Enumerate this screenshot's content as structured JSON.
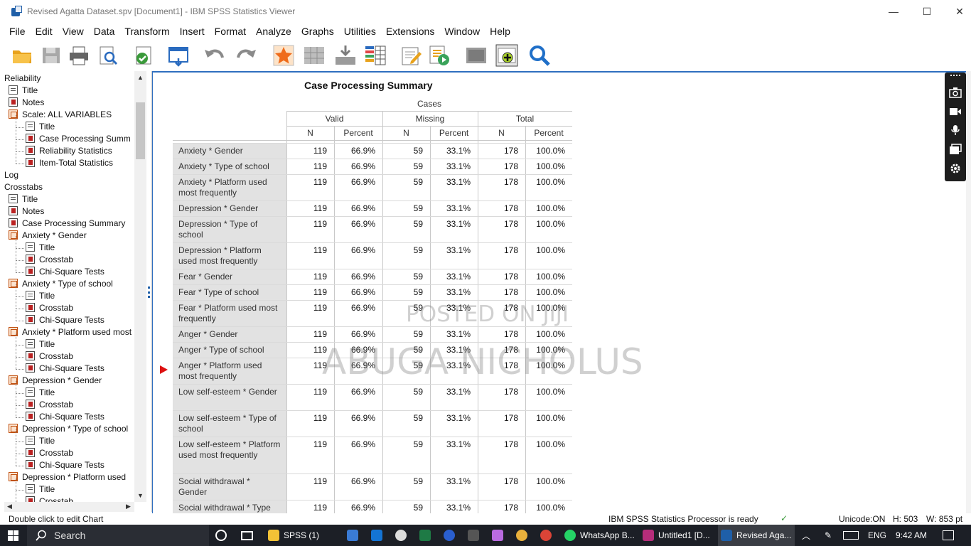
{
  "window": {
    "title": "Revised Agatta Dataset.spv [Document1] - IBM SPSS Statistics Viewer",
    "min_glyph": "—",
    "max_glyph": "☐",
    "close_glyph": "✕"
  },
  "menu": [
    "File",
    "Edit",
    "View",
    "Data",
    "Transform",
    "Insert",
    "Format",
    "Analyze",
    "Graphs",
    "Utilities",
    "Extensions",
    "Window",
    "Help"
  ],
  "toolbar_icons": [
    "open-folder-icon",
    "save-icon",
    "print-icon",
    "print-preview-icon",
    "export-icon",
    "recall-dialog-icon",
    "undo-icon",
    "redo-icon",
    "goto-data-icon",
    "goto-case-icon",
    "insert-output-icon",
    "variables-icon",
    "designate-window-icon",
    "edit-syntax-icon",
    "run-script-icon",
    "show-hide-icon",
    "insert-item-icon",
    "find-icon"
  ],
  "outline": {
    "items": [
      {
        "label": "Reliability",
        "icon": "none",
        "level": 0
      },
      {
        "label": "Title",
        "icon": "page",
        "level": 1
      },
      {
        "label": "Notes",
        "icon": "table",
        "level": 1
      },
      {
        "label": "Scale: ALL VARIABLES",
        "icon": "book",
        "level": 1
      },
      {
        "label": "Title",
        "icon": "page",
        "level": 2
      },
      {
        "label": "Case Processing Summ",
        "icon": "table",
        "level": 2
      },
      {
        "label": "Reliability Statistics",
        "icon": "table",
        "level": 2
      },
      {
        "label": "Item-Total Statistics",
        "icon": "table",
        "level": 2
      },
      {
        "label": "Log",
        "icon": "none",
        "level": 0
      },
      {
        "label": "Crosstabs",
        "icon": "none",
        "level": 0
      },
      {
        "label": "Title",
        "icon": "page",
        "level": 1
      },
      {
        "label": "Notes",
        "icon": "table",
        "level": 1
      },
      {
        "label": "Case Processing Summary",
        "icon": "table",
        "level": 1
      },
      {
        "label": "Anxiety  * Gender",
        "icon": "book",
        "level": 1
      },
      {
        "label": "Title",
        "icon": "page",
        "level": 2
      },
      {
        "label": "Crosstab",
        "icon": "table",
        "level": 2
      },
      {
        "label": "Chi-Square Tests",
        "icon": "table",
        "level": 2
      },
      {
        "label": "Anxiety  * Type of school",
        "icon": "book",
        "level": 1
      },
      {
        "label": "Title",
        "icon": "page",
        "level": 2
      },
      {
        "label": "Crosstab",
        "icon": "table",
        "level": 2
      },
      {
        "label": "Chi-Square Tests",
        "icon": "table",
        "level": 2
      },
      {
        "label": "Anxiety  * Platform used most",
        "icon": "book",
        "level": 1
      },
      {
        "label": "Title",
        "icon": "page",
        "level": 2
      },
      {
        "label": "Crosstab",
        "icon": "table",
        "level": 2
      },
      {
        "label": "Chi-Square Tests",
        "icon": "table",
        "level": 2
      },
      {
        "label": "Depression  * Gender",
        "icon": "book",
        "level": 1
      },
      {
        "label": "Title",
        "icon": "page",
        "level": 2
      },
      {
        "label": "Crosstab",
        "icon": "table",
        "level": 2
      },
      {
        "label": "Chi-Square Tests",
        "icon": "table",
        "level": 2
      },
      {
        "label": "Depression  * Type of school",
        "icon": "book",
        "level": 1
      },
      {
        "label": "Title",
        "icon": "page",
        "level": 2
      },
      {
        "label": "Crosstab",
        "icon": "table",
        "level": 2
      },
      {
        "label": "Chi-Square Tests",
        "icon": "table",
        "level": 2
      },
      {
        "label": "Depression  * Platform used",
        "icon": "book",
        "level": 1
      },
      {
        "label": "Title",
        "icon": "page",
        "level": 2
      },
      {
        "label": "Crosstab",
        "icon": "table",
        "level": 2
      }
    ]
  },
  "table": {
    "title": "Case Processing Summary",
    "cases_header": "Cases",
    "groups": [
      "Valid",
      "Missing",
      "Total"
    ],
    "subheaders": [
      "N",
      "Percent",
      "N",
      "Percent",
      "N",
      "Percent"
    ],
    "rows": [
      {
        "label": "Anxiety  * Gender",
        "lines": 1,
        "values": [
          "119",
          "66.9%",
          "59",
          "33.1%",
          "178",
          "100.0%"
        ]
      },
      {
        "label": "Anxiety  * Type of school",
        "lines": 1,
        "values": [
          "119",
          "66.9%",
          "59",
          "33.1%",
          "178",
          "100.0%"
        ]
      },
      {
        "label": "Anxiety  * Platform used most frequently",
        "lines": 2,
        "values": [
          "119",
          "66.9%",
          "59",
          "33.1%",
          "178",
          "100.0%"
        ]
      },
      {
        "label": "Depression  * Gender",
        "lines": 1,
        "values": [
          "119",
          "66.9%",
          "59",
          "33.1%",
          "178",
          "100.0%"
        ]
      },
      {
        "label": "Depression  * Type of school",
        "lines": 2,
        "values": [
          "119",
          "66.9%",
          "59",
          "33.1%",
          "178",
          "100.0%"
        ]
      },
      {
        "label": "Depression  * Platform used most frequently",
        "lines": 2,
        "values": [
          "119",
          "66.9%",
          "59",
          "33.1%",
          "178",
          "100.0%"
        ]
      },
      {
        "label": "Fear  * Gender",
        "lines": 1,
        "values": [
          "119",
          "66.9%",
          "59",
          "33.1%",
          "178",
          "100.0%"
        ]
      },
      {
        "label": "Fear  * Type of school",
        "lines": 1,
        "values": [
          "119",
          "66.9%",
          "59",
          "33.1%",
          "178",
          "100.0%"
        ]
      },
      {
        "label": "Fear  * Platform used most frequently",
        "lines": 2,
        "values": [
          "119",
          "66.9%",
          "59",
          "33.1%",
          "178",
          "100.0%"
        ]
      },
      {
        "label": "Anger  * Gender",
        "lines": 1,
        "values": [
          "119",
          "66.9%",
          "59",
          "33.1%",
          "178",
          "100.0%"
        ]
      },
      {
        "label": "Anger  * Type of school",
        "lines": 1,
        "values": [
          "119",
          "66.9%",
          "59",
          "33.1%",
          "178",
          "100.0%"
        ]
      },
      {
        "label": "Anger  * Platform used most frequently",
        "lines": 2,
        "values": [
          "119",
          "66.9%",
          "59",
          "33.1%",
          "178",
          "100.0%"
        ]
      },
      {
        "label": "Low self-esteem  * Gender",
        "lines": 2,
        "values": [
          "119",
          "66.9%",
          "59",
          "33.1%",
          "178",
          "100.0%"
        ]
      },
      {
        "label": "Low self-esteem  * Type of school",
        "lines": 2,
        "values": [
          "119",
          "66.9%",
          "59",
          "33.1%",
          "178",
          "100.0%"
        ]
      },
      {
        "label": "Low self-esteem  * Platform used most frequently",
        "lines": 3,
        "values": [
          "119",
          "66.9%",
          "59",
          "33.1%",
          "178",
          "100.0%"
        ]
      },
      {
        "label": "Social withdrawal  * Gender",
        "lines": 2,
        "values": [
          "119",
          "66.9%",
          "59",
          "33.1%",
          "178",
          "100.0%"
        ]
      },
      {
        "label": "Social withdrawal  * Type",
        "lines": 1,
        "values": [
          "119",
          "66.9%",
          "59",
          "33.1%",
          "178",
          "100.0%"
        ]
      }
    ]
  },
  "watermark": {
    "line1": "POSTED ON JIJI",
    "line2": "ABUGA NICHOLUS"
  },
  "status": {
    "left": "Double click to edit Chart",
    "processor": "IBM SPSS Statistics Processor is ready",
    "unicode": "Unicode:ON",
    "height": "H: 503",
    "width": "W: 853 pt"
  },
  "taskbar": {
    "search": "Search",
    "spss_folder": "SPSS (1)",
    "whatsapp": "WhatsApp B...",
    "untitled": "Untitled1 [D...",
    "revised": "Revised Aga...",
    "lang": "ENG",
    "time": "9:42 AM"
  },
  "colors": {
    "accent": "#2f6fbf",
    "label_bg": "#e2e2e2",
    "taskbar": "#1c1f26",
    "marker": "#dd1111"
  }
}
